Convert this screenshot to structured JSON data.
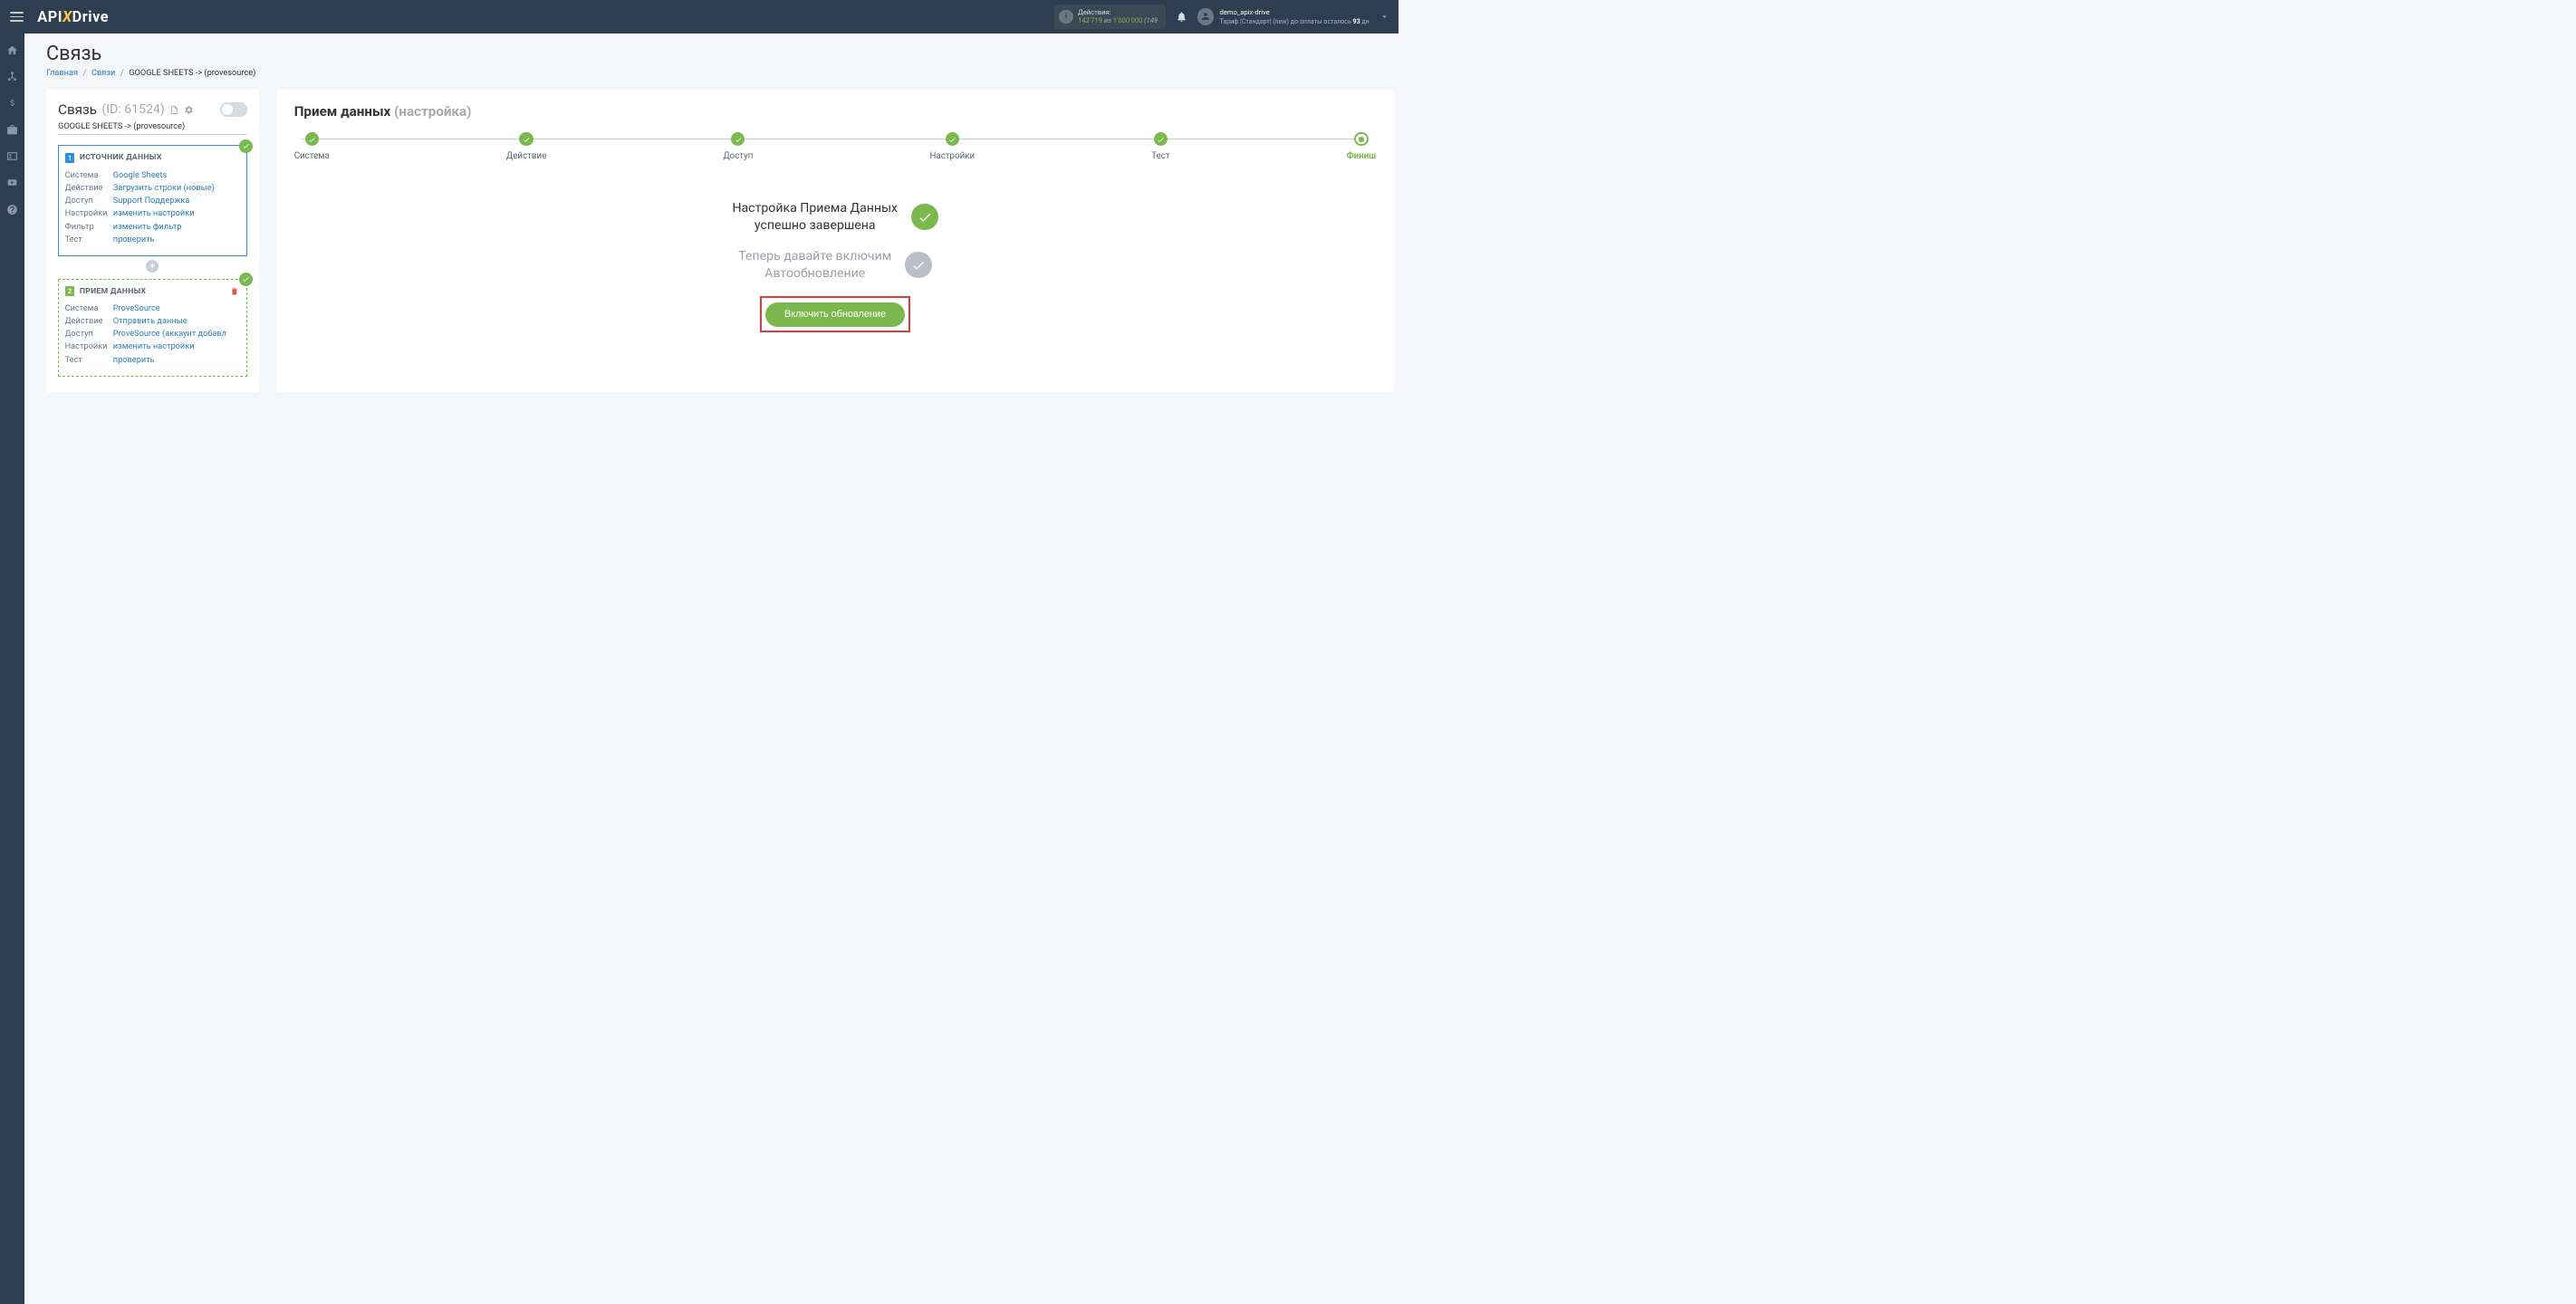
{
  "header": {
    "logo": {
      "api": "API",
      "x": "X",
      "drive": "Drive"
    },
    "actions": {
      "label": "Действия:",
      "count": "142'719",
      "of_word": "из",
      "limit": "1'000'000",
      "truncated": "(149"
    },
    "user": {
      "name": "demo_apix-drive",
      "plan_prefix": "Тариф |Стандарт| (new) до оплаты осталось ",
      "days": "93",
      "plan_suffix": " дн"
    }
  },
  "page": {
    "title": "Связь",
    "breadcrumb": {
      "home": "Главная",
      "links": "Связи",
      "current": "GOOGLE SHEETS -> (provesource)"
    }
  },
  "leftPanel": {
    "title": "Связь",
    "idLabel": "(ID: 61524)",
    "connectionName": "GOOGLE SHEETS -> (provesource)",
    "source": {
      "num": "1",
      "title": "ИСТОЧНИК ДАННЫХ",
      "rows": [
        {
          "key": "Система",
          "val": "Google Sheets"
        },
        {
          "key": "Действие",
          "val": "Загрузить строки (новые)"
        },
        {
          "key": "Доступ",
          "val": "Support Поддержка"
        },
        {
          "key": "Настройки",
          "val": "изменить настройки"
        },
        {
          "key": "Фильтр",
          "val": "изменить фильтр"
        },
        {
          "key": "Тест",
          "val": "проверить"
        }
      ]
    },
    "dest": {
      "num": "2",
      "title": "ПРИЕМ ДАННЫХ",
      "rows": [
        {
          "key": "Система",
          "val": "ProveSource"
        },
        {
          "key": "Действие",
          "val": "Отправить данные"
        },
        {
          "key": "Доступ",
          "val": "ProveSource (аккаунт добавл"
        },
        {
          "key": "Настройки",
          "val": "изменить настройки"
        },
        {
          "key": "Тест",
          "val": "проверить"
        }
      ]
    }
  },
  "rightPanel": {
    "title": "Прием данных",
    "subtitle": "(настройка)",
    "steps": [
      "Система",
      "Действие",
      "Доступ",
      "Настройки",
      "Тест",
      "Финиш"
    ],
    "status1_line1": "Настройка Приема Данных",
    "status1_line2": "успешно завершена",
    "status2_line1": "Теперь давайте включим",
    "status2_line2": "Автообновление",
    "buttonLabel": "Включить обновление"
  }
}
